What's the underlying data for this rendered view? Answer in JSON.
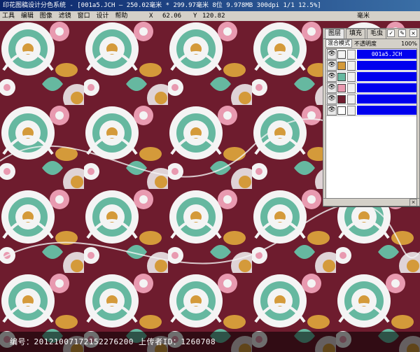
{
  "window": {
    "title": "印花图稿设计分色系统 - [001a5.JCH — 250.02毫米 * 299.97毫米 8位  9.978MB 300dpi 1/1  12.5%]"
  },
  "menu": {
    "items": [
      "工具",
      "编辑",
      "图像",
      "滤镜",
      "窗口",
      "设计",
      "帮助"
    ]
  },
  "coords": {
    "x_label": "X",
    "x_value": "62.06",
    "y_label": "Y",
    "y_value": "120.82",
    "unit": "毫米"
  },
  "layer_panel": {
    "tabs": [
      "图层",
      "填充",
      "毛虫"
    ],
    "blend_mode": "混合模式",
    "opacity_label": "不透明度",
    "opacity_value": "100%",
    "layers": [
      {
        "name": "001a5.JCH",
        "color": "#f4f4f4"
      },
      {
        "name": "",
        "color": "#d49a3a"
      },
      {
        "name": "",
        "color": "#66b8a0"
      },
      {
        "name": "",
        "color": "#e89ab0"
      },
      {
        "name": "",
        "color": "#6e1c2e"
      },
      {
        "name": "",
        "color": "#ffffff"
      }
    ]
  },
  "watermark": {
    "text": "编号：20121007172152276200  上传者ID：1260708"
  },
  "colors": {
    "maroon": "#6e1c2e",
    "white": "#f4f4f4",
    "mustard": "#d49a3a",
    "teal": "#66b8a0",
    "pink": "#e89ab0",
    "layer_blue": "#0000ee"
  }
}
